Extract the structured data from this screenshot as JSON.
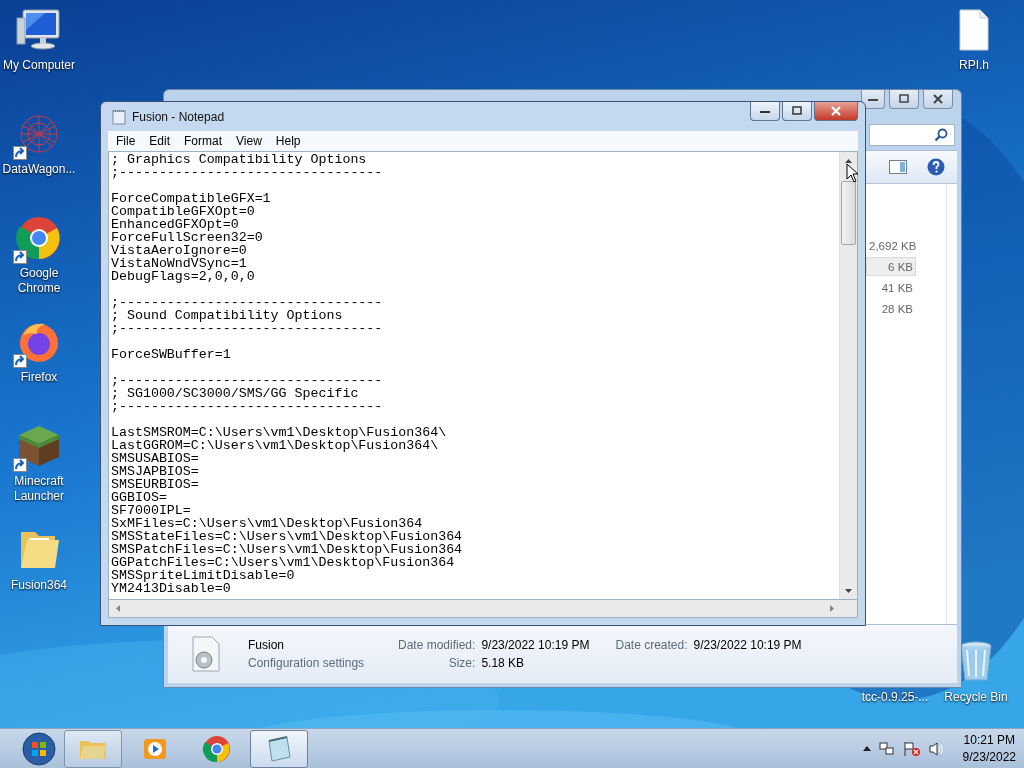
{
  "desktop_icons": [
    {
      "label": "My Computer",
      "kind": "computer",
      "shortcut": false
    },
    {
      "label": "DataWagon...",
      "kind": "network",
      "shortcut": true
    },
    {
      "label": "Google Chrome",
      "kind": "chrome",
      "shortcut": true
    },
    {
      "label": "Firefox",
      "kind": "firefox",
      "shortcut": true
    },
    {
      "label": "Minecraft Launcher",
      "kind": "minecraft",
      "shortcut": true
    },
    {
      "label": "Fusion364",
      "kind": "folder",
      "shortcut": false
    }
  ],
  "desktop_icons_right": [
    {
      "label": "RPI.h",
      "kind": "file"
    },
    {
      "label": "tcc-0.9.25-...",
      "kind": "covered"
    },
    {
      "label": "Recycle Bin",
      "kind": "recycle"
    }
  ],
  "explorer": {
    "files": [
      {
        "size": "2,692 KB",
        "selected": false
      },
      {
        "size": "6 KB",
        "selected": true
      },
      {
        "size": "41 KB",
        "selected": false
      },
      {
        "size": "28 KB",
        "selected": false
      }
    ],
    "details": {
      "name": "Fusion",
      "type": "Configuration settings",
      "fields": [
        {
          "label": "Date modified:",
          "value": "9/23/2022 10:19 PM"
        },
        {
          "label": "Date created:",
          "value": "9/23/2022 10:19 PM"
        },
        {
          "label": "Size:",
          "value": "5.18 KB"
        }
      ]
    }
  },
  "notepad": {
    "title": "Fusion - Notepad",
    "menu": [
      "File",
      "Edit",
      "Format",
      "View",
      "Help"
    ],
    "blocks": [
      [
        "; Graphics Compatibility Options",
        ";---------------------------------"
      ],
      [
        "ForceCompatibleGFX=1",
        "CompatibleGFXOpt=0",
        "EnhancedGFXOpt=0",
        "ForceFullScreen32=0",
        "VistaAeroIgnore=0",
        "VistaNoWndVSync=1",
        "DebugFlags=2,0,0,0"
      ],
      [
        ";---------------------------------",
        "; Sound Compatibility Options",
        ";---------------------------------"
      ],
      [
        "ForceSWBuffer=1"
      ],
      [
        ";---------------------------------",
        "; SG1000/SC3000/SMS/GG Specific",
        ";---------------------------------"
      ],
      [
        "LastSMSROM=C:\\Users\\vm1\\Desktop\\Fusion364\\",
        "LastGGROM=C:\\Users\\vm1\\Desktop\\Fusion364\\",
        "SMSUSABIOS=",
        "SMSJAPBIOS=",
        "SMSEURBIOS=",
        "GGBIOS=",
        "SF7000IPL=",
        "SxMFiles=C:\\Users\\vm1\\Desktop\\Fusion364",
        "SMSStateFiles=C:\\Users\\vm1\\Desktop\\Fusion364",
        "SMSPatchFiles=C:\\Users\\vm1\\Desktop\\Fusion364",
        "GGPatchFiles=C:\\Users\\vm1\\Desktop\\Fusion364",
        "SMSSpriteLimitDisable=0",
        "YM2413Disable=0"
      ]
    ]
  },
  "taskbar": {
    "items": [
      {
        "kind": "explorer",
        "open": true,
        "selected": false
      },
      {
        "kind": "media",
        "open": false,
        "selected": false
      },
      {
        "kind": "chrome",
        "open": false,
        "selected": false
      },
      {
        "kind": "notepad",
        "open": true,
        "selected": true
      }
    ],
    "clock": {
      "time": "10:21 PM",
      "date": "9/23/2022"
    }
  }
}
